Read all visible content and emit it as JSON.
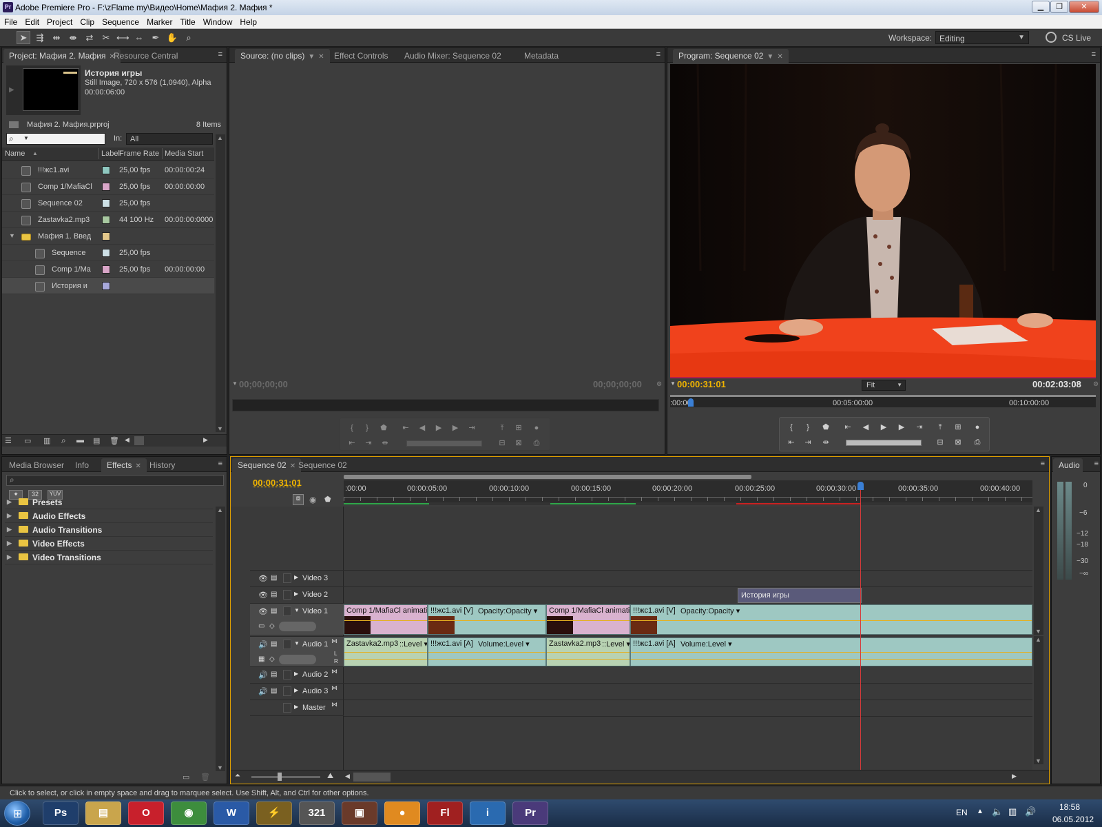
{
  "window": {
    "title": "Adobe Premiere Pro - F:\\zFlame my\\Видео\\Home\\Мафия 2. Мафия *",
    "app_badge": "Pr",
    "min": "▁",
    "max": "❐",
    "close": "✕"
  },
  "menu": [
    "File",
    "Edit",
    "Project",
    "Clip",
    "Sequence",
    "Marker",
    "Title",
    "Window",
    "Help"
  ],
  "toolbar": {
    "workspace_label": "Workspace:",
    "workspace_value": "Editing",
    "cs_live": "CS Live"
  },
  "project_panel": {
    "tabs": [
      "Project: Мафия 2. Мафия",
      "Resource Central"
    ],
    "preview": {
      "name": "История игры",
      "info": "Still Image, 720 x 576 (1,0940), Alpha",
      "duration": "00:00:06:00"
    },
    "project_file": "Мафия 2. Мафия.prproj",
    "item_count": "8 Items",
    "in_label": "In:",
    "in_value": "All",
    "columns": [
      "Name",
      "Label",
      "Frame Rate",
      "Media Start"
    ],
    "rows": [
      {
        "name": "!!!жс1.avi",
        "label_color": "#8fc8c0",
        "rate": "25,00 fps",
        "start": "00:00:00:24",
        "indent": 0,
        "icon": "video-file-icon"
      },
      {
        "name": "Comp 1/MafiaCl",
        "label_color": "#d9a6c8",
        "rate": "25,00 fps",
        "start": "00:00:00:00",
        "indent": 0,
        "icon": "composition-icon"
      },
      {
        "name": "Sequence 02",
        "label_color": "#cde0e6",
        "rate": "25,00 fps",
        "start": "",
        "indent": 0,
        "icon": "sequence-icon"
      },
      {
        "name": "Zastavka2.mp3",
        "label_color": "#a8c8a0",
        "rate": "44 100 Hz",
        "start": "00:00:00:0000",
        "indent": 0,
        "icon": "audio-file-icon"
      },
      {
        "name": "Мафия 1. Введ",
        "label_color": "#e3c78a",
        "rate": "",
        "start": "",
        "indent": 0,
        "icon": "bin-folder-icon"
      },
      {
        "name": "Sequence",
        "label_color": "#cde0e6",
        "rate": "25,00 fps",
        "start": "",
        "indent": 1,
        "icon": "sequence-icon"
      },
      {
        "name": "Comp 1/Ma",
        "label_color": "#d9a6c8",
        "rate": "25,00 fps",
        "start": "00:00:00:00",
        "indent": 1,
        "icon": "composition-icon"
      },
      {
        "name": "История и",
        "label_color": "#a7a8dc",
        "rate": "",
        "start": "",
        "indent": 1,
        "icon": "still-image-icon"
      }
    ]
  },
  "source_panel": {
    "tabs": [
      "Source: (no clips)",
      "Effect Controls",
      "Audio Mixer: Sequence 02",
      "Metadata"
    ],
    "timecode_in": "00;00;00;00",
    "timecode_out": "00;00;00;00"
  },
  "program_panel": {
    "tab": "Program: Sequence 02",
    "timecode": "00:00:31:01",
    "fit": "Fit",
    "duration": "00:02:03:08",
    "ruler": [
      ":00:00",
      "00:05:00:00",
      "00:10:00:00"
    ]
  },
  "effects_panel": {
    "tabs": [
      "Media Browser",
      "Info",
      "Effects",
      "History"
    ],
    "badges": [
      "32",
      "YUV"
    ],
    "items": [
      "Presets",
      "Audio Effects",
      "Audio Transitions",
      "Video Effects",
      "Video Transitions"
    ]
  },
  "timeline": {
    "tabs": [
      "Sequence 02",
      "Sequence 02"
    ],
    "timecode": "00:00:31:01",
    "ruler": [
      ":00:00",
      "00:00:05:00",
      "00:00:10:00",
      "00:00:15:00",
      "00:00:20:00",
      "00:00:25:00",
      "00:00:30:00",
      "00:00:35:00",
      "00:00:40:00"
    ],
    "tracks": [
      "Video 3",
      "Video 2",
      "Video 1",
      "Audio 1",
      "Audio 2",
      "Audio 3",
      "Master"
    ],
    "audio1_lr": [
      "L",
      "R"
    ],
    "video2_clip": "История игры",
    "video1_clips": [
      {
        "name": "Comp 1/MafiaCl animatio",
        "color": "#d9b2cf"
      },
      {
        "name": "!!!жс1.avi [V]",
        "fx": "Opacity:Opacity ▾",
        "color": "#9ec8c2"
      },
      {
        "name": "Comp 1/MafiaCl animatio",
        "color": "#d9b2cf"
      },
      {
        "name": "!!!жс1.avi [V]",
        "fx": "Opacity:Opacity ▾",
        "color": "#9ec8c2"
      }
    ],
    "audio1_clips": [
      {
        "name": "Zastavka2.mp3",
        "fx": "::Level ▾",
        "color": "#b8d2b2"
      },
      {
        "name": "!!!жс1.avi [A]",
        "fx": "Volume:Level ▾",
        "color": "#9ec8c2"
      },
      {
        "name": "Zastavka2.mp3",
        "fx": "::Level ▾",
        "color": "#b8d2b2"
      },
      {
        "name": "!!!жс1.avi [A]",
        "fx": "Volume:Level ▾",
        "color": "#9ec8c2"
      }
    ]
  },
  "audio_meter": {
    "tab": "Audio",
    "levels": [
      "0",
      "−6",
      "−12",
      "−18",
      "−30",
      "−∞"
    ]
  },
  "status_bar": "Click to select, or click in empty space and drag to marquee select. Use Shift, Alt, and Ctrl for other options.",
  "taskbar": {
    "apps": [
      {
        "name": "photoshop",
        "label": "Ps",
        "color": "#1f3e6b"
      },
      {
        "name": "explorer",
        "label": "▤",
        "color": "#c9a54c"
      },
      {
        "name": "opera",
        "label": "O",
        "color": "#c8202c"
      },
      {
        "name": "chrome",
        "label": "◉",
        "color": "#3d8d3d"
      },
      {
        "name": "word",
        "label": "W",
        "color": "#2a5aa6"
      },
      {
        "name": "winamp",
        "label": "⚡",
        "color": "#7a6020"
      },
      {
        "name": "media-player-classic",
        "label": "321",
        "color": "#555555"
      },
      {
        "name": "video-app",
        "label": "▣",
        "color": "#6a3a2a"
      },
      {
        "name": "player",
        "label": "●",
        "color": "#e08a20"
      },
      {
        "name": "flash",
        "label": "Fl",
        "color": "#a02020"
      },
      {
        "name": "info-app",
        "label": "i",
        "color": "#2a6ab0"
      },
      {
        "name": "premiere",
        "label": "Pr",
        "color": "#4a3a7a"
      }
    ],
    "lang": "EN",
    "time": "18:58",
    "date": "06.05.2012"
  }
}
